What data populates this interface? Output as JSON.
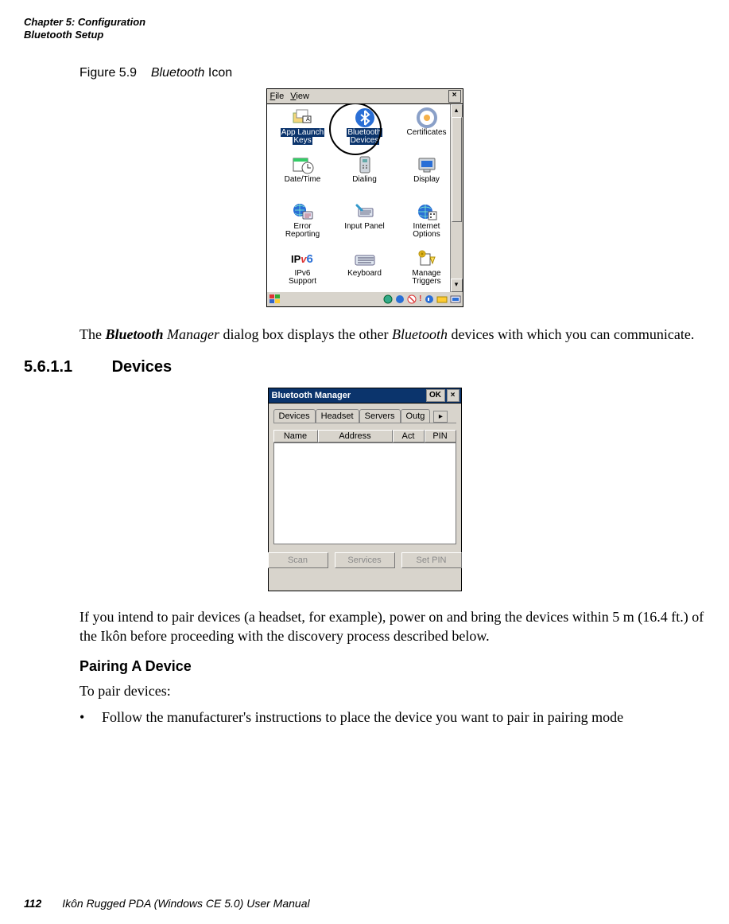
{
  "header": {
    "chapter_line": "Chapter 5:  Configuration",
    "section_line": "Bluetooth Setup"
  },
  "figure": {
    "label": "Figure 5.9",
    "title_em": "Bluetooth",
    "title_rest": " Icon"
  },
  "screenshot1": {
    "menu_file": "File",
    "menu_view": "View",
    "close_x": "×",
    "items": [
      {
        "name": "app-launch-keys-icon",
        "label_1": "App Launch",
        "label_2": "Keys"
      },
      {
        "name": "bluetooth-devices-icon",
        "label_1": "Bluetooth",
        "label_2": "Devices",
        "highlight": true
      },
      {
        "name": "certificates-icon",
        "label_1": "Certificates",
        "label_2": ""
      },
      {
        "name": "date-time-icon",
        "label_1": "Date/Time",
        "label_2": ""
      },
      {
        "name": "dialing-icon",
        "label_1": "Dialing",
        "label_2": ""
      },
      {
        "name": "display-icon",
        "label_1": "Display",
        "label_2": ""
      },
      {
        "name": "error-reporting-icon",
        "label_1": "Error",
        "label_2": "Reporting"
      },
      {
        "name": "input-panel-icon",
        "label_1": "Input Panel",
        "label_2": ""
      },
      {
        "name": "internet-options-icon",
        "label_1": "Internet",
        "label_2": "Options"
      },
      {
        "name": "ipv6-support-icon",
        "label_1": "IPv6",
        "label_2": "Support"
      },
      {
        "name": "keyboard-icon",
        "label_1": "Keyboard",
        "label_2": ""
      },
      {
        "name": "manage-triggers-icon",
        "label_1": "Manage",
        "label_2": "Triggers"
      }
    ],
    "scroll_up": "▴",
    "scroll_down": "▾"
  },
  "para1_pre": "The ",
  "para1_strongem": "Bluetooth",
  "para1_em": " Manager",
  "para1_mid": " dialog box displays the other ",
  "para1_em2": "Bluetooth",
  "para1_post": " devices with which you can communicate.",
  "heading": {
    "num": "5.6.1.1",
    "title": "Devices"
  },
  "screenshot2": {
    "title": "Bluetooth Manager",
    "ok": "OK",
    "close_x": "×",
    "tabs": {
      "devices": "Devices",
      "headset": "Headset",
      "servers": "Servers",
      "outgoing": "Outg",
      "arrow": "▸"
    },
    "columns": {
      "name": "Name",
      "address": "Address",
      "act": "Act",
      "pin": "PIN"
    },
    "buttons": {
      "scan": "Scan",
      "services": "Services",
      "set_pin": "Set PIN"
    }
  },
  "para2": "If you intend to pair devices (a headset, for example), power on and bring the devices within 5 m (16.4 ft.) of the Ikôn before proceeding with the discovery process described below.",
  "heading_sub": "Pairing A Device",
  "para3": "To pair devices:",
  "bullet1": "Follow the manufacturer's instructions to place the device you want to pair in pairing mode",
  "footer": {
    "page": "112",
    "text": "Ikôn Rugged PDA (Windows CE 5.0) User Manual"
  }
}
